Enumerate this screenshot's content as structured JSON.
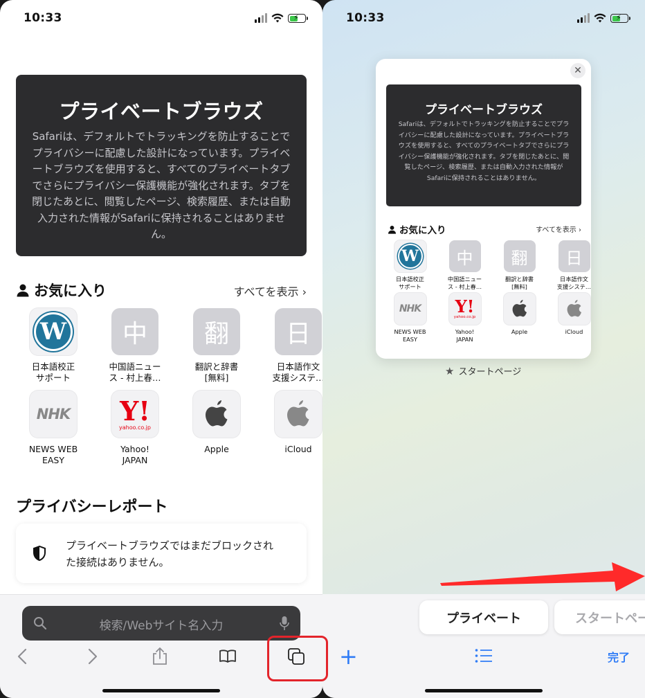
{
  "status": {
    "time": "10:33"
  },
  "private_intro": {
    "title": "プライベートブラウズ",
    "body": "Safariは、デフォルトでトラッキングを防止することでプライバシーに配慮した設計になっています。プライベートブラウズを使用すると、すべてのプライベートタブでさらにプライバシー保護機能が強化されます。タブを閉じたあとに、閲覧したページ、検索履歴、または自動入力された情報がSafariに保持されることはありません。"
  },
  "favorites": {
    "title": "お気に入り",
    "show_all": "すべてを表示 ›",
    "items": [
      {
        "label": "日本語校正\nサポート",
        "icon": "wordpress-icon"
      },
      {
        "label": "中国語ニュー\nス - 村上春…",
        "icon": "中"
      },
      {
        "label": "翻訳と辞書\n[無料]",
        "icon": "翻"
      },
      {
        "label": "日本語作文\n支援システ…",
        "icon": "日"
      },
      {
        "label": "NEWS WEB\nEASY",
        "icon": "nhk-logo"
      },
      {
        "label": "Yahoo!\nJAPAN",
        "icon": "yahoo-logo"
      },
      {
        "label": "Apple",
        "icon": "apple-icon"
      },
      {
        "label": "iCloud",
        "icon": "apple-icon"
      }
    ],
    "logos": {
      "nhk": "NHK",
      "yahoo": "Y!",
      "yahoo_domain": "yahoo.co.jp"
    }
  },
  "privacy_report": {
    "title": "プライバシーレポート",
    "message": "プライベートブラウズではまだブロックされた接続はありません。"
  },
  "search": {
    "placeholder": "検索/Webサイト名入力"
  },
  "tab_overview": {
    "start_page_label": "スタートページ",
    "group_private": "プライベート",
    "group_start": "スタートペー",
    "done": "完了",
    "close_glyph": "✕"
  },
  "colors": {
    "dark_card": "#2c2c2e",
    "accent_blue": "#2f7cf6",
    "highlight_red": "#e3242b",
    "arrow_red": "#ff2a2a"
  }
}
